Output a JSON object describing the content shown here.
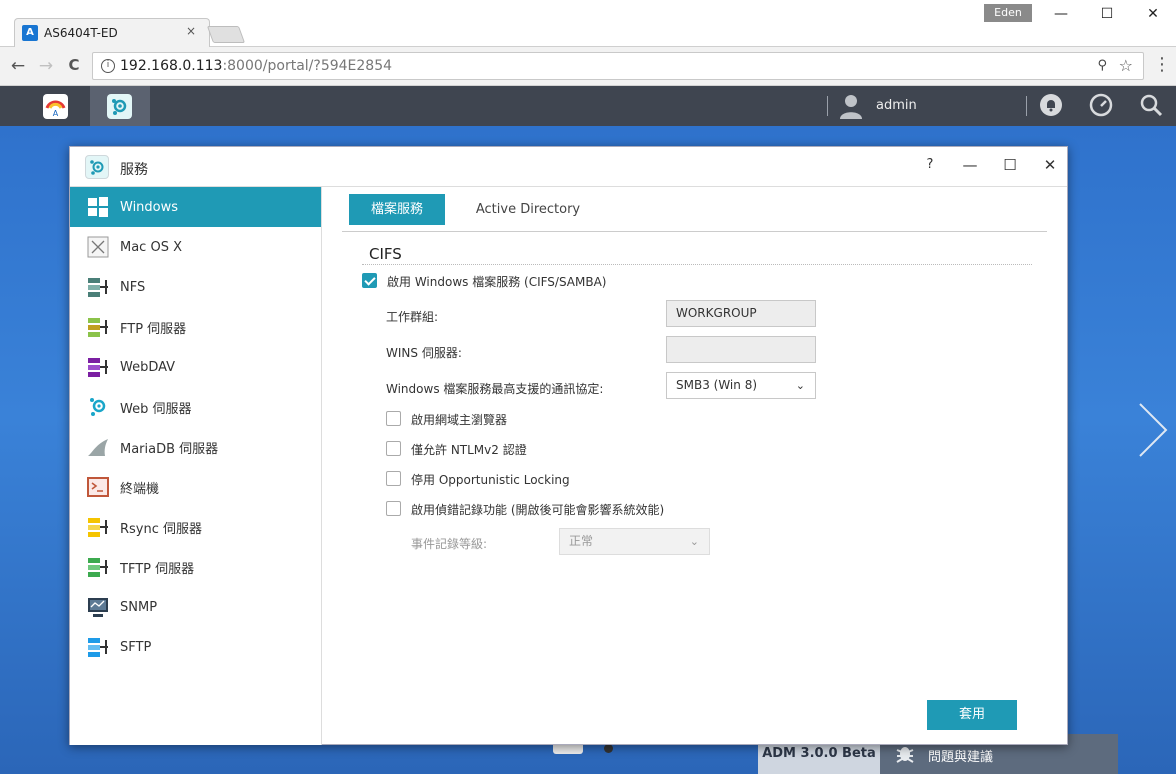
{
  "browser": {
    "tab_title": "AS6404T-ED",
    "tab_favicon": "A",
    "tab_close": "×",
    "user_badge": "Eden",
    "minimize": "—",
    "maximize": "☐",
    "close": "✕",
    "back": "←",
    "forward": "→",
    "reload": "C",
    "url_host": "192.168.0.113",
    "url_rest": ":8000/portal/?594E2854",
    "menu": "⋮"
  },
  "adm": {
    "user": "admin"
  },
  "window": {
    "title": "服務",
    "help": "?",
    "minimize": "—",
    "maximize": "☐",
    "close": "✕"
  },
  "sidebar": {
    "items": [
      {
        "label": "Windows",
        "icon": "windows-icon",
        "color": "#1f9ab5"
      },
      {
        "label": "Mac OS X",
        "icon": "apple-icon",
        "color": "#888888"
      },
      {
        "label": "NFS",
        "icon": "nfs-icon",
        "color": "#4a7f78"
      },
      {
        "label": "FTP 伺服器",
        "icon": "ftp-icon",
        "color": "#8bc34a"
      },
      {
        "label": "WebDAV",
        "icon": "webdav-icon",
        "color": "#7b1fa2"
      },
      {
        "label": "Web 伺服器",
        "icon": "web-server-icon",
        "color": "#1aa6c9"
      },
      {
        "label": "MariaDB 伺服器",
        "icon": "mariadb-icon",
        "color": "#7f8c8d"
      },
      {
        "label": "終端機",
        "icon": "terminal-icon",
        "color": "#c0573a"
      },
      {
        "label": "Rsync 伺服器",
        "icon": "rsync-icon",
        "color": "#f5c400"
      },
      {
        "label": "TFTP 伺服器",
        "icon": "tftp-icon",
        "color": "#3caa4f"
      },
      {
        "label": "SNMP",
        "icon": "snmp-icon",
        "color": "#2c3e50"
      },
      {
        "label": "SFTP",
        "icon": "sftp-icon",
        "color": "#1e9be8"
      }
    ]
  },
  "tabs": {
    "file_service": "檔案服務",
    "active_directory": "Active Directory"
  },
  "cifs": {
    "section": "CIFS",
    "enable_label": "啟用 Windows 檔案服務 (CIFS/SAMBA)",
    "enable_checked": true,
    "workgroup_label": "工作群組:",
    "workgroup_value": "WORKGROUP",
    "wins_label": "WINS 伺服器:",
    "wins_value": "",
    "protocol_label": "Windows 檔案服務最高支援的通訊協定:",
    "protocol_value": "SMB3 (Win 8)",
    "opt_master_browser": "啟用網域主瀏覽器",
    "opt_ntlmv2": "僅允許 NTLMv2 認證",
    "opt_oplocks": "停用 Opportunistic Locking",
    "opt_debug_log": "啟用偵錯記錄功能 (開啟後可能會影響系統效能)",
    "log_level_label": "事件記錄等級:",
    "log_level_value": "正常",
    "apply": "套用"
  },
  "dock": {
    "version": "ADM 3.0.0 Beta",
    "feedback": "問題與建議"
  }
}
